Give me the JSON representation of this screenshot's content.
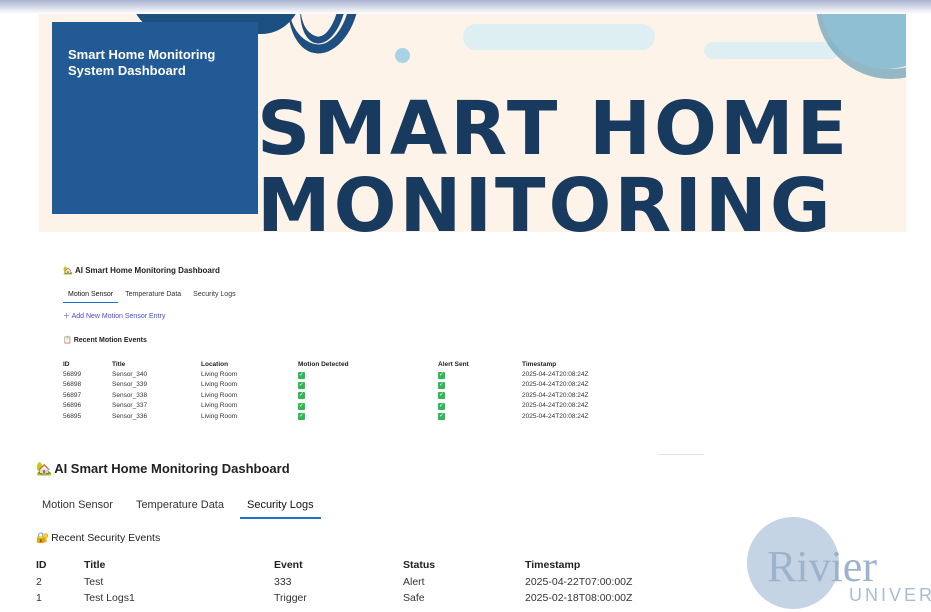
{
  "hero": {
    "box_title": "Smart Home Monitoring System Dashboard",
    "headline_line1": "SMART HOME",
    "headline_line2": "MONITORING"
  },
  "small_dashboard": {
    "title_icon": "house-emoji",
    "title": "AI Smart Home Monitoring Dashboard",
    "tabs": [
      "Motion Sensor",
      "Temperature Data",
      "Security Logs"
    ],
    "active_tab": "Motion Sensor",
    "add_entry_label": "Add New Motion Sensor Entry",
    "recent_icon": "clipboard-emoji",
    "recent_heading": "Recent Motion Events",
    "columns": [
      "ID",
      "Title",
      "Location",
      "Motion Detected",
      "Alert Sent",
      "Timestamp"
    ],
    "rows": [
      {
        "id": "56899",
        "title": "Sensor_340",
        "location": "Living Room",
        "motion": true,
        "alert": true,
        "timestamp": "2025-04-24T20:08:24Z"
      },
      {
        "id": "56898",
        "title": "Sensor_339",
        "location": "Living Room",
        "motion": true,
        "alert": true,
        "timestamp": "2025-04-24T20:08:24Z"
      },
      {
        "id": "56897",
        "title": "Sensor_338",
        "location": "Living Room",
        "motion": true,
        "alert": true,
        "timestamp": "2025-04-24T20:08:24Z"
      },
      {
        "id": "56896",
        "title": "Sensor_337",
        "location": "Living Room",
        "motion": true,
        "alert": true,
        "timestamp": "2025-04-24T20:08:24Z"
      },
      {
        "id": "56895",
        "title": "Sensor_336",
        "location": "Living Room",
        "motion": true,
        "alert": true,
        "timestamp": "2025-04-24T20:08:24Z"
      }
    ]
  },
  "large_dashboard": {
    "title_icon": "house-emoji",
    "title": "AI Smart Home Monitoring Dashboard",
    "tabs": [
      "Motion Sensor",
      "Temperature Data",
      "Security Logs"
    ],
    "active_tab": "Security Logs",
    "recent_icon": "lock-emoji",
    "recent_heading": "Recent Security Events",
    "columns": [
      "ID",
      "Title",
      "Event",
      "Status",
      "Timestamp"
    ],
    "rows": [
      {
        "id": "2",
        "title": "Test",
        "event": "333",
        "status": "Alert",
        "timestamp": "2025-04-22T07:00:00Z"
      },
      {
        "id": "1",
        "title": "Test Logs1",
        "event": "Trigger",
        "status": "Safe",
        "timestamp": "2025-02-18T08:00:00Z"
      }
    ]
  },
  "logo": {
    "word": "Rivier",
    "sub": "UNIVERSI"
  },
  "colors": {
    "hero_bg": "#fdf3e8",
    "title_box": "#215a94",
    "headline": "#173a5e",
    "tab_active": "#1a73c8",
    "add_link": "#4a4ae0",
    "check": "#2fb855"
  }
}
